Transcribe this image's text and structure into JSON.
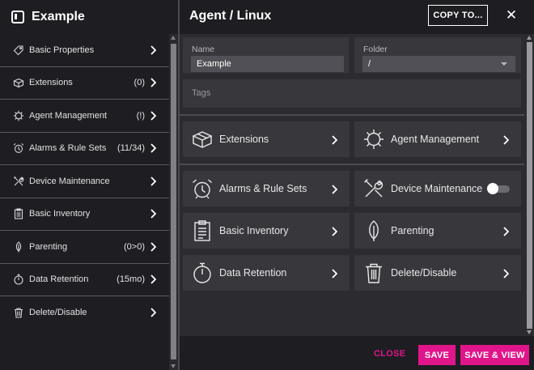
{
  "sidebar": {
    "title": "Example",
    "items": [
      {
        "label": "Basic Properties",
        "badge": "",
        "icon": "tag-icon"
      },
      {
        "label": "Extensions",
        "badge": "(0)",
        "icon": "package-icon"
      },
      {
        "label": "Agent Management",
        "badge": "(!)",
        "icon": "gear-icon"
      },
      {
        "label": "Alarms & Rule Sets",
        "badge": "(11/34)",
        "icon": "alarm-clock-icon"
      },
      {
        "label": "Device Maintenance",
        "badge": "",
        "icon": "tools-icon"
      },
      {
        "label": "Basic Inventory",
        "badge": "",
        "icon": "clipboard-icon"
      },
      {
        "label": "Parenting",
        "badge": "(0>0)",
        "icon": "leaf-icon"
      },
      {
        "label": "Data Retention",
        "badge": "(15mo)",
        "icon": "stopwatch-icon"
      },
      {
        "label": "Delete/Disable",
        "badge": "",
        "icon": "trash-icon"
      }
    ]
  },
  "header": {
    "title": "Agent / Linux",
    "copy_label": "COPY TO...",
    "close_glyph": "✕"
  },
  "form": {
    "name_label": "Name",
    "name_value": "Example",
    "folder_label": "Folder",
    "folder_value": "/",
    "tags_placeholder": "Tags"
  },
  "cards": {
    "extensions": "Extensions",
    "agent_management": "Agent Management",
    "alarms": "Alarms & Rule Sets",
    "device_maintenance": "Device Maintenance",
    "device_maintenance_enabled": false,
    "basic_inventory": "Basic Inventory",
    "parenting": "Parenting",
    "data_retention": "Data Retention",
    "delete_disable": "Delete/Disable"
  },
  "footer": {
    "close_label": "CLOSE",
    "save_label": "SAVE",
    "save_view_label": "SAVE & VIEW"
  },
  "colors": {
    "accent": "#e0158a",
    "sidebar_bg": "#1e1e22",
    "panel_bg": "#2c2c30",
    "card_bg": "#38383c"
  }
}
